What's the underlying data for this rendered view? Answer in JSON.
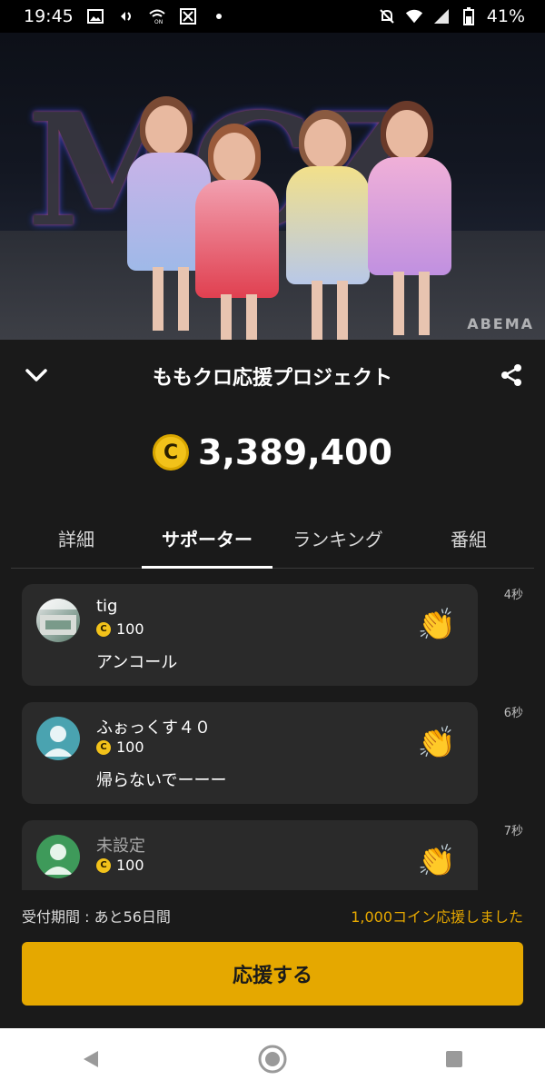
{
  "status_bar": {
    "time": "19:45",
    "battery": "41%",
    "left_icons": [
      "image-icon",
      "sound-icon",
      "wifi-calling-icon",
      "x-app-icon",
      "dot-icon"
    ],
    "right_icons": [
      "mute-bell-icon",
      "wifi-icon",
      "signal-icon",
      "battery-icon"
    ]
  },
  "video": {
    "sign_text": "MCZ",
    "watermark": "ABEMA"
  },
  "header": {
    "title": "ももクロ応援プロジェクト"
  },
  "coin_total": "3,389,400",
  "coin_symbol": "C",
  "tabs": [
    {
      "label": "詳細",
      "active": false
    },
    {
      "label": "サポーター",
      "active": true
    },
    {
      "label": "ランキング",
      "active": false
    },
    {
      "label": "番組",
      "active": false
    }
  ],
  "supporters": [
    {
      "name": "tig",
      "amount": "100",
      "message": "アンコール",
      "time": "4秒",
      "avatar": "photo"
    },
    {
      "name": "ふぉっくす４０",
      "amount": "100",
      "message": "帰らないでーーー",
      "time": "6秒",
      "avatar": "teal-default"
    },
    {
      "name": "未設定",
      "amount": "100",
      "message": "",
      "time": "7秒",
      "avatar": "green-default"
    }
  ],
  "footer": {
    "period": "受付期間 : あと56日間",
    "my_support": "1,000コイン応援しました",
    "button_label": "応援する"
  },
  "colors": {
    "accent": "#e5a800",
    "coin": "#f2c21a",
    "background": "#1a1a1a",
    "card": "#2a2a2a"
  }
}
